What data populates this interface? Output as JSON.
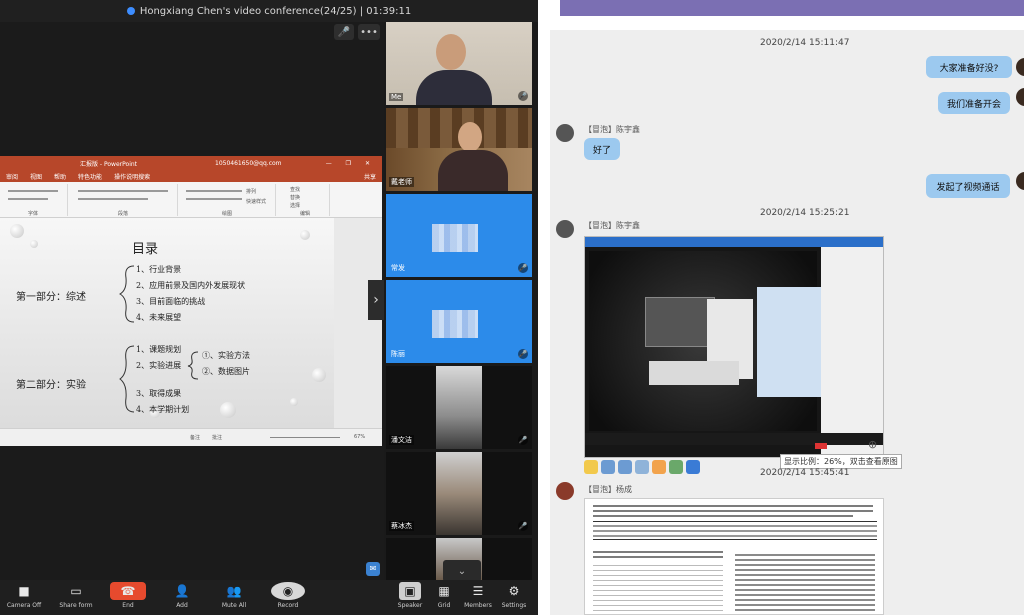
{
  "zoom": {
    "title": "Hongxiang Chen's video conference(24/25) | 01:39:11",
    "top_buttons": {
      "mic": "🎤",
      "more": "•••"
    },
    "collapse_glyph": "›",
    "scroll_down_glyph": "⌄",
    "participants": [
      {
        "name": "Me"
      },
      {
        "name": "戴老师"
      },
      {
        "name": "常发"
      },
      {
        "name": "陈丽"
      },
      {
        "name": "潘文洁"
      },
      {
        "name": "蔡冰杰"
      },
      {
        "name": ""
      }
    ],
    "toolbar": [
      {
        "label": "Camera Off",
        "icon": "camera-icon"
      },
      {
        "label": "Share form",
        "icon": "share-screen-icon"
      },
      {
        "label": "End",
        "icon": "end-call-icon"
      },
      {
        "label": "Add",
        "icon": "add-user-icon"
      },
      {
        "label": "Mute All",
        "icon": "mute-all-icon"
      },
      {
        "label": "Record",
        "icon": "record-icon"
      },
      {
        "label": "Speaker",
        "icon": "speaker-view-icon"
      },
      {
        "label": "Grid",
        "icon": "grid-view-icon"
      },
      {
        "label": "Members",
        "icon": "members-icon"
      },
      {
        "label": "Settings",
        "icon": "settings-icon"
      }
    ]
  },
  "ppt": {
    "doc_title": "汇报版 - PowerPoint",
    "account": "1050461650@qq.com",
    "share_label": "共享",
    "win_buttons": "— ❐ ✕",
    "tabs": [
      "审阅",
      "视图",
      "帮助",
      "特色功能",
      "操作说明搜索"
    ],
    "ribbon": {
      "group_labels": [
        "字体",
        "段落",
        "绘图",
        "编辑"
      ],
      "editing": [
        "查找",
        "替换",
        "选择"
      ],
      "draw_buttons": [
        "排列",
        "快速样式"
      ]
    },
    "status": {
      "notes": "备注",
      "comments": "批注",
      "zoom": "67%"
    },
    "slide": {
      "heading": "目录",
      "part1": "第一部分：综述",
      "part1_items": [
        "1、行业背景",
        "2、应用前景及国内外发展现状",
        "3、目前面临的挑战",
        "4、未来展望"
      ],
      "part2": "第二部分：实验",
      "part2_items": [
        "1、课题规划",
        "2、实验进展",
        "3、取得成果",
        "4、本学期计划"
      ],
      "part2_sub": [
        "①、实验方法",
        "②、数据图片"
      ]
    }
  },
  "chat": {
    "timestamps": [
      "2020/2/14 15:11:47",
      "2020/2/14 15:25:21",
      "2020/2/14 15:45:41"
    ],
    "sent": [
      "大家准备好没?",
      "我们准备开会",
      "发起了视频通话"
    ],
    "senders": [
      "【冒泡】陈宇鑫",
      "【冒泡】陈宇鑫",
      "【冒泡】杨成"
    ],
    "reply": "好了",
    "image_tooltip": "显示比例：26%，双击查看原图",
    "colors": {
      "sent_bubble": "#9cc9ef",
      "chat_bg": "#eeeeee",
      "top_bar": "#7b6fb3",
      "end_button": "#e64a2e",
      "ppt_accent": "#b7472a"
    }
  }
}
